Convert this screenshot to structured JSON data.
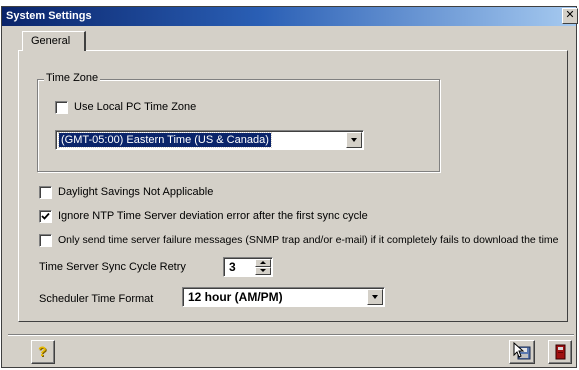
{
  "window": {
    "title": "System Settings",
    "close_glyph": "✕"
  },
  "tabs": [
    {
      "label": "General",
      "active": true
    }
  ],
  "time_zone": {
    "legend": "Time Zone",
    "use_local_label": "Use Local PC Time Zone",
    "use_local_checked": false,
    "selected": "(GMT-05:00) Eastern Time (US & Canada)"
  },
  "options": [
    {
      "label": "Daylight Savings Not Applicable",
      "checked": false
    },
    {
      "label": "Ignore NTP Time Server deviation error after the first sync cycle",
      "checked": true
    },
    {
      "label": "Only send time server failure messages (SNMP trap and/or e-mail) if it completely fails to download the time",
      "checked": false
    }
  ],
  "sync_retry": {
    "label": "Time Server Sync Cycle Retry",
    "value": "3"
  },
  "time_format": {
    "label": "Scheduler Time Format",
    "selected": "12 hour (AM/PM)"
  },
  "buttons": {
    "help": {
      "icon": "help-icon",
      "glyph": "?"
    },
    "save": {
      "icon": "save-icon"
    },
    "exit": {
      "icon": "exit-icon"
    }
  },
  "colors": {
    "window_bg": "#d4d0c8",
    "titlebar_start": "#0a246a",
    "titlebar_end": "#a6caf0",
    "selection": "#0a246a"
  }
}
